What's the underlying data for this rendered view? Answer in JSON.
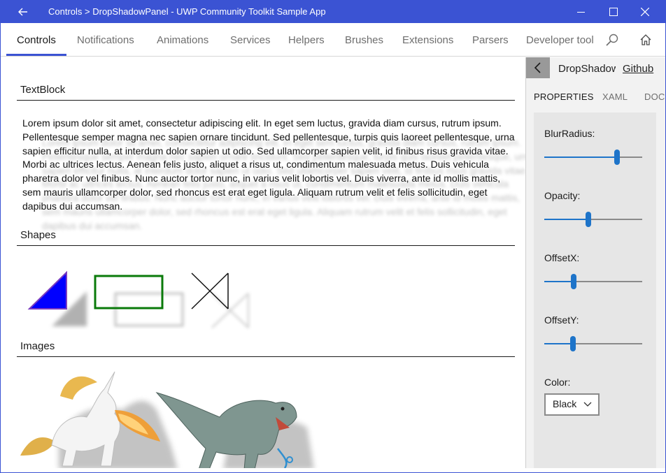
{
  "window": {
    "title": "Controls > DropShadowPanel - UWP Community Toolkit Sample App",
    "accent_color": "#3b53d3"
  },
  "nav": {
    "tabs": [
      {
        "label": "Controls",
        "active": true
      },
      {
        "label": "Notifications"
      },
      {
        "label": "Animations"
      },
      {
        "label": "Services"
      },
      {
        "label": "Helpers"
      },
      {
        "label": "Brushes"
      },
      {
        "label": "Extensions"
      },
      {
        "label": "Parsers"
      },
      {
        "label": "Developer tool"
      }
    ],
    "icons": [
      "search-icon",
      "home-icon"
    ]
  },
  "sample": {
    "textblock_header": "TextBlock",
    "paragraph": "Lorem ipsum dolor sit amet, consectetur adipiscing elit. In eget sem luctus, gravida diam cursus, rutrum ipsum. Pellentesque semper magna nec sapien ornare tincidunt. Sed pellentesque, turpis quis laoreet pellentesque, urna sapien efficitur nulla, at interdum dolor sapien ut odio. Sed ullamcorper sapien velit, id finibus risus gravida vitae. Morbi ac ultrices lectus. Aenean felis justo, aliquet a risus ut, condimentum malesuada metus. Duis vehicula pharetra dolor vel finibus. Nunc auctor tortor nunc, in varius velit lobortis vel. Duis viverra, ante id mollis mattis, sem mauris ullamcorper dolor, sed rhoncus est erat eget ligula. Aliquam rutrum velit et felis sollicitudin, eget dapibus dui accumsan.",
    "shapes_header": "Shapes",
    "images_header": "Images",
    "shape_colors": {
      "triangle_fill": "#0000ff",
      "triangle_edge": "#6a3cc0",
      "rectangle_stroke": "#0a7a0a",
      "bowtie_stroke": "#111111"
    }
  },
  "panel": {
    "title": "DropShadowPanel",
    "github_link": "Github",
    "tabs": [
      {
        "label": "PROPERTIES",
        "active": true
      },
      {
        "label": "XAML"
      },
      {
        "label": "DOC"
      }
    ],
    "properties": [
      {
        "label": "BlurRadius:",
        "value_fraction": 0.76
      },
      {
        "label": "Opacity:",
        "value_fraction": 0.45
      },
      {
        "label": "OffsetX:",
        "value_fraction": 0.29
      },
      {
        "label": "OffsetY:",
        "value_fraction": 0.28
      }
    ],
    "color_label": "Color:",
    "color_value": "Black",
    "slider_color": "#1e74c9"
  }
}
